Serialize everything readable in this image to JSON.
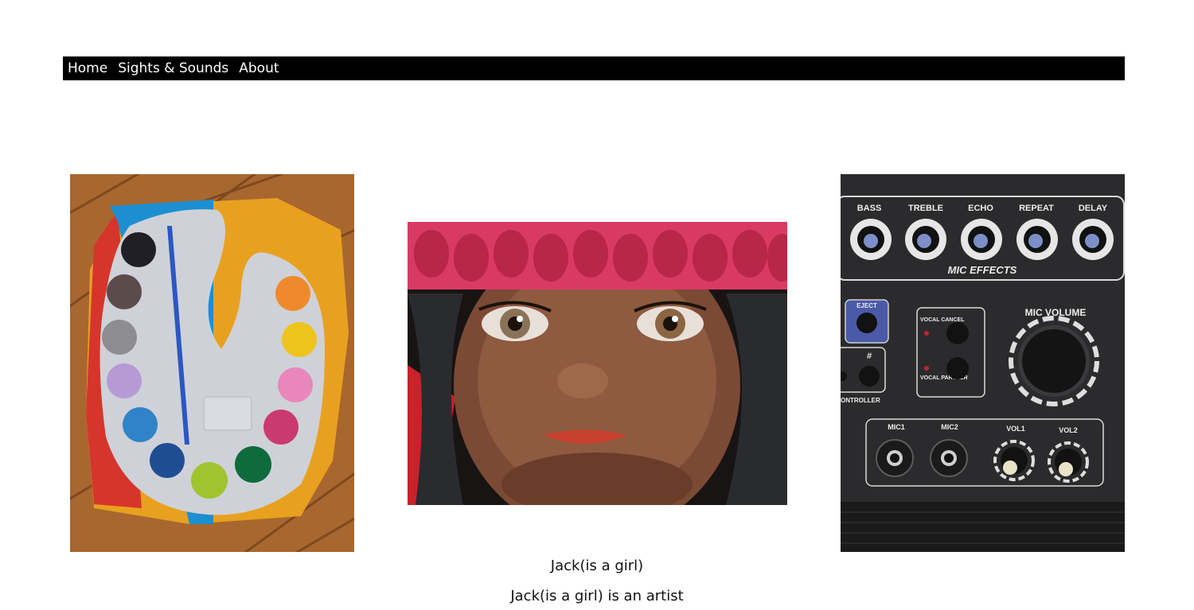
{
  "nav": {
    "items": [
      {
        "label": "Home"
      },
      {
        "label": "Sights & Sounds"
      },
      {
        "label": "About"
      }
    ]
  },
  "gallery": {
    "amp_labels": {
      "knobs": [
        "BASS",
        "TREBLE",
        "ECHO",
        "REPEAT",
        "DELAY"
      ],
      "mic_effects": "MIC EFFECTS",
      "eject": "EJECT",
      "vocal_cancel": "VOCAL CANCEL",
      "vocal_partner": "VOCAL PARTNER",
      "mic_volume": "MIC VOLUME",
      "hash": "#",
      "controller": "ONTROLLER",
      "jacks": [
        "MIC1",
        "MIC2",
        "VOL1",
        "VOL2"
      ]
    }
  },
  "captions": {
    "line1": "Jack(is a girl)",
    "line2": "Jack(is a girl) is an artist"
  },
  "colors": {
    "navbar_bg": "#000000",
    "nav_text": "#ffffff"
  }
}
